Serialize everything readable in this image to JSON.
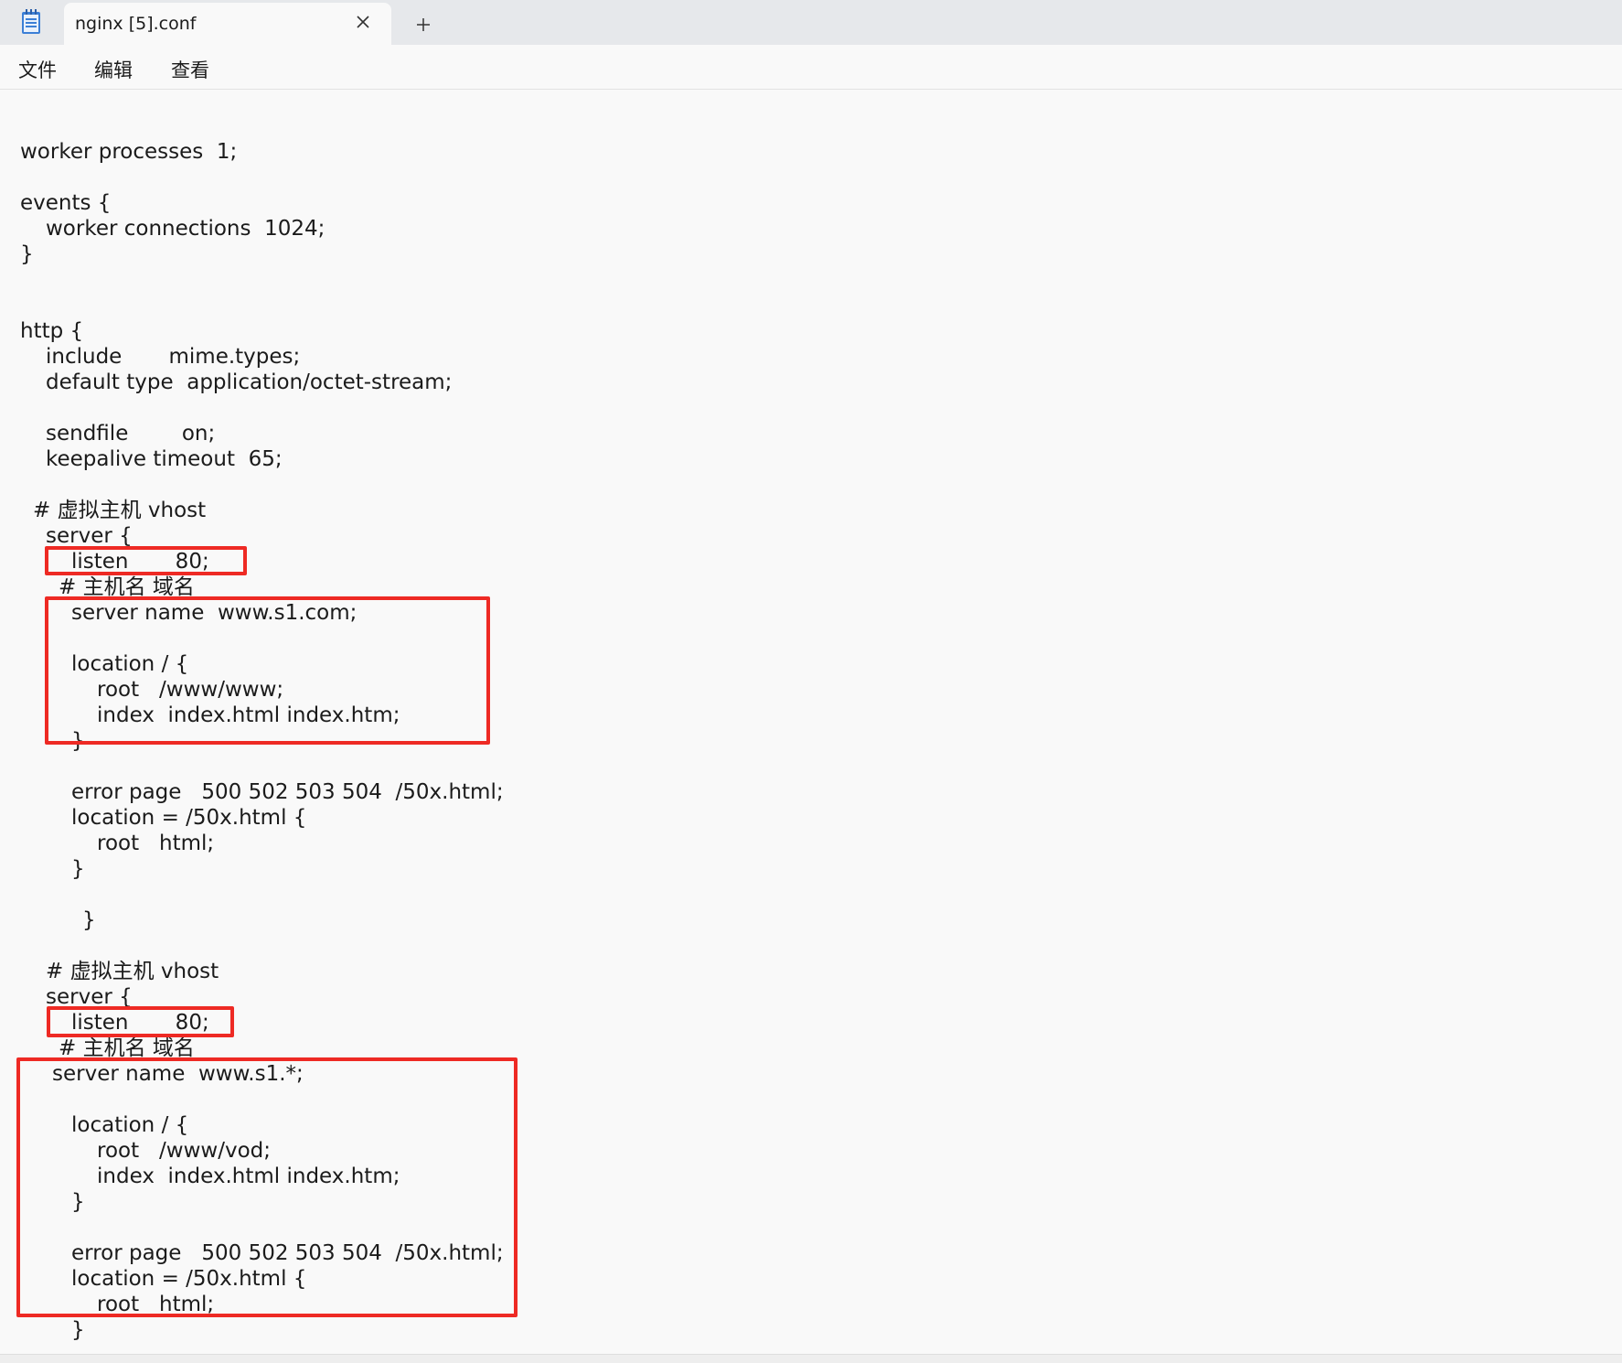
{
  "window": {
    "app_icon": "notepad-icon",
    "tab_title": "nginx [5].conf",
    "close_icon": "close-icon",
    "new_tab_icon": "plus-icon"
  },
  "menu": {
    "items": [
      "文件",
      "编辑",
      "查看"
    ]
  },
  "editor": {
    "lines": [
      "worker processes  1;",
      "events {",
      "worker connections  1024;",
      "}",
      "http {",
      "include       mime.types;",
      "default type  application/octet-stream;",
      "sendfile        on;",
      "keepalive timeout  65;",
      "# 虚拟主机 vhost",
      "server {",
      "listen       80;",
      "# 主机名 域名",
      "server name  www.s1.com;",
      "location / {",
      "root   /www/www;",
      "index  index.html index.htm;",
      "}",
      "error page   500 502 503 504  /50x.html;",
      "location = /50x.html {",
      "root   html;",
      "}",
      "}",
      "# 虚拟主机 vhost",
      "server {",
      "listen       80;",
      "# 主机名 域名",
      "server name  www.s1.*;",
      "location / {",
      "root   /www/vod;",
      "index  index.html index.htm;",
      "}",
      "error page   500 502 503 504  /50x.html;",
      "location = /50x.html {",
      "root   html;",
      "}"
    ]
  },
  "annotations": {
    "highlight_color": "#ee2a24"
  }
}
